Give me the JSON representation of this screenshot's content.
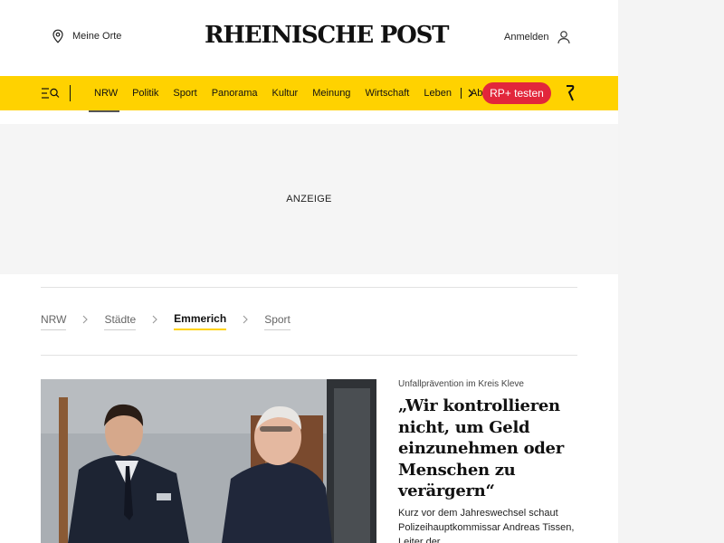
{
  "header": {
    "locations_label": "Meine Orte",
    "logo": "RHEINISCHE POST",
    "login_label": "Anmelden"
  },
  "nav": {
    "items": [
      "NRW",
      "Politik",
      "Sport",
      "Panorama",
      "Kultur",
      "Meinung",
      "Wirtschaft",
      "Leben",
      "Abo"
    ],
    "cta_label": "RP+ testen"
  },
  "ad": {
    "label": "ANZEIGE"
  },
  "breadcrumb": {
    "items": [
      "NRW",
      "Städte",
      "Emmerich",
      "Sport"
    ],
    "active_index": 2
  },
  "article": {
    "kicker": "Unfallprävention im Kreis Kleve",
    "headline": "„Wir kontrollieren nicht, um Geld einzunehmen oder Menschen zu verärgern“",
    "teaser": "Kurz vor dem Jahreswechsel schaut Polizeihauptkommissar Andreas Tissen, Leiter der"
  },
  "colors": {
    "nav_background": "#ffd200",
    "cta_background": "#e2263b",
    "active_crumb_underline": "#ffd200"
  }
}
